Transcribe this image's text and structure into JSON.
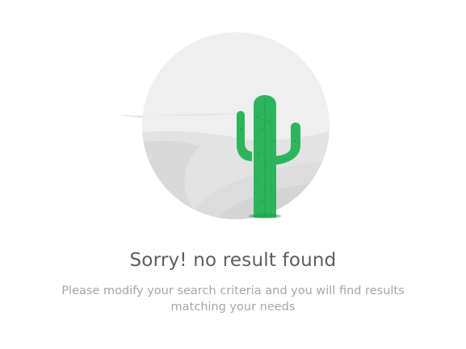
{
  "empty_state": {
    "title": "Sorry! no result found",
    "message": "Please modify your search criteria and you will find results matching your needs",
    "illustration_icon": "desert-cactus-icon"
  },
  "colors": {
    "circle_bg": "#efefef",
    "dune_light": "#e1e1e1",
    "dune_dark": "#d6d6d6",
    "cactus": "#2db55d",
    "cactus_dark": "#1f9a4b",
    "title_text": "#5e5e5e",
    "message_text": "#a6a6a6"
  }
}
